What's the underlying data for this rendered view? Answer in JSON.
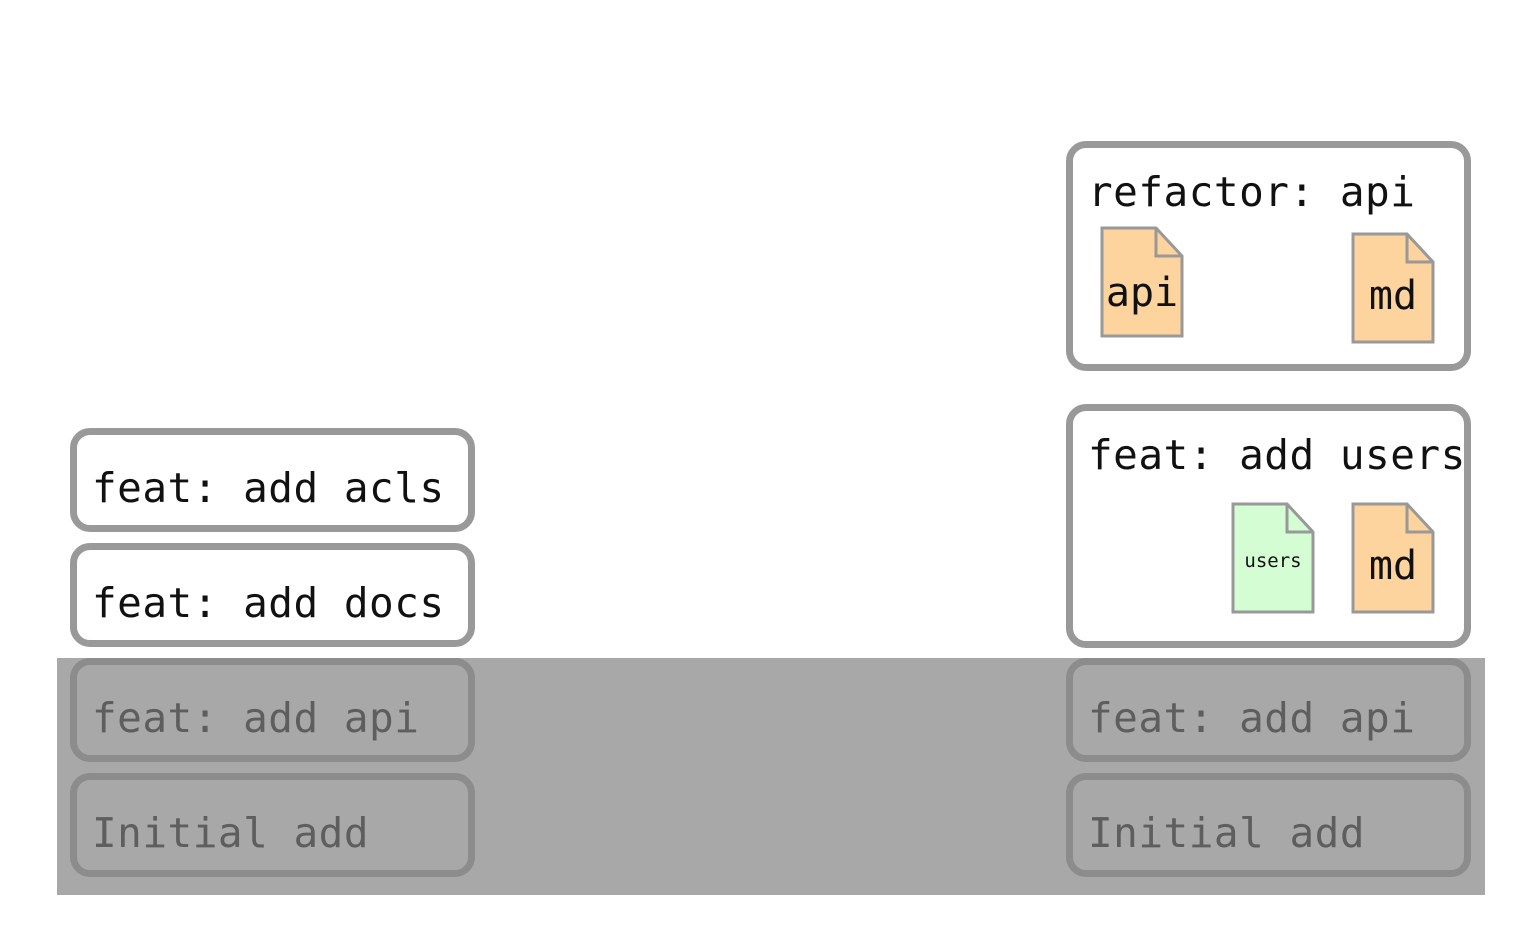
{
  "colors": {
    "commit_border": "#999999",
    "shared_history_band": "#a8a8a8",
    "file_modified": "#fdd49e",
    "file_added": "#d4fdd4",
    "file_border": "#999999"
  },
  "left_branch": {
    "commits": [
      {
        "label": "feat: add acls"
      },
      {
        "label": "feat: add docs"
      },
      {
        "label": "feat: add api"
      },
      {
        "label": "Initial add"
      }
    ]
  },
  "right_branch": {
    "commits": [
      {
        "label": "refactor: api",
        "files": [
          {
            "name": "api",
            "status": "modified",
            "icon": "file-icon"
          },
          {
            "name": "md",
            "status": "modified",
            "icon": "file-icon"
          }
        ]
      },
      {
        "label": "feat: add users",
        "files": [
          {
            "name": "users",
            "status": "added",
            "icon": "file-icon"
          },
          {
            "name": "md",
            "status": "modified",
            "icon": "file-icon"
          }
        ]
      },
      {
        "label": "feat: add api"
      },
      {
        "label": "Initial add"
      }
    ]
  }
}
